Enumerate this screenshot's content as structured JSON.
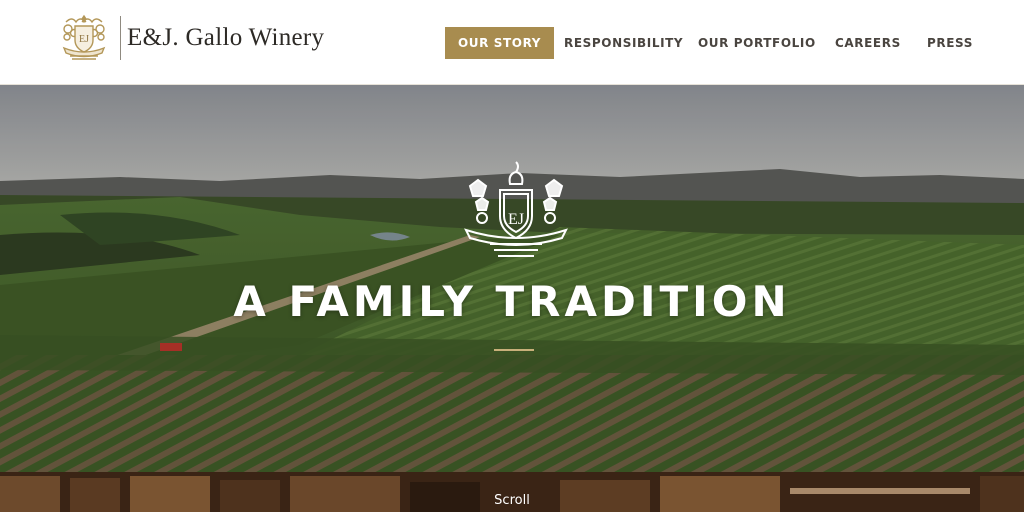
{
  "brand": {
    "name": "E&J. Gallo Winery",
    "crest_icon": "crest-logo-icon",
    "gold": "#a88c4f"
  },
  "nav": {
    "items": [
      {
        "label": "OUR STORY",
        "active": true
      },
      {
        "label": "RESPONSIBILITY",
        "active": false
      },
      {
        "label": "OUR PORTFOLIO",
        "active": false
      },
      {
        "label": "CAREERS",
        "active": false
      },
      {
        "label": "PRESS",
        "active": false
      }
    ]
  },
  "hero": {
    "title": "A FAMILY TRADITION",
    "emblem_icon": "ej-crest-emblem-icon",
    "rule_color": "#c8b07a"
  },
  "lower": {
    "scroll_label": "Scroll"
  }
}
